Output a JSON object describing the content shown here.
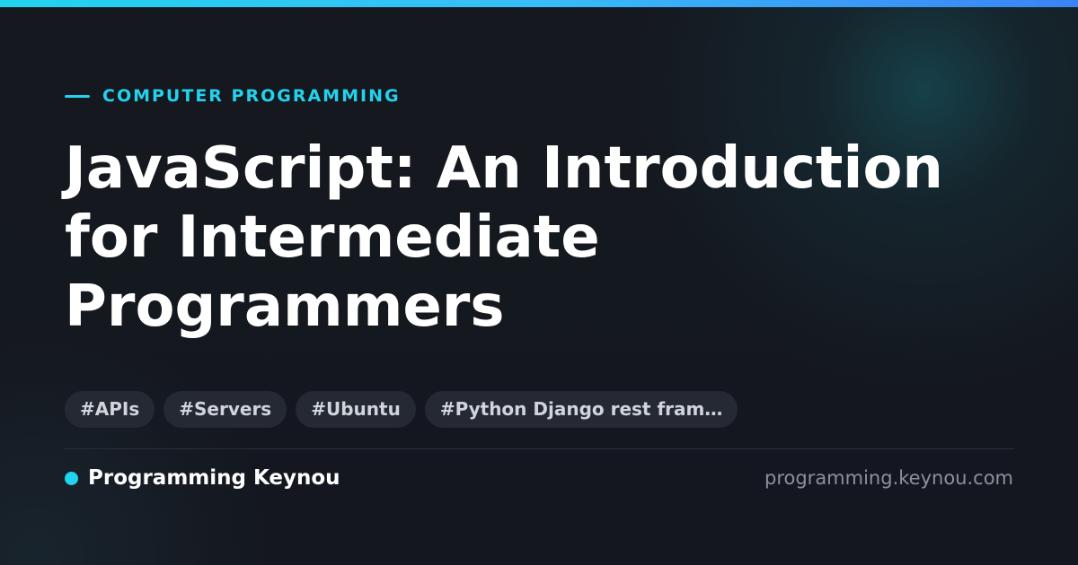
{
  "accent_color": "#22d3ee",
  "category": "COMPUTER PROGRAMMING",
  "title": "JavaScript: An Introduction for Intermediate Programmers",
  "tags": [
    "#APIs",
    "#Servers",
    "#Ubuntu",
    "#Python Django rest fram…"
  ],
  "brand": {
    "name": "Programming Keynou",
    "icon": "dot-icon"
  },
  "site_url": "programming.keynou.com"
}
